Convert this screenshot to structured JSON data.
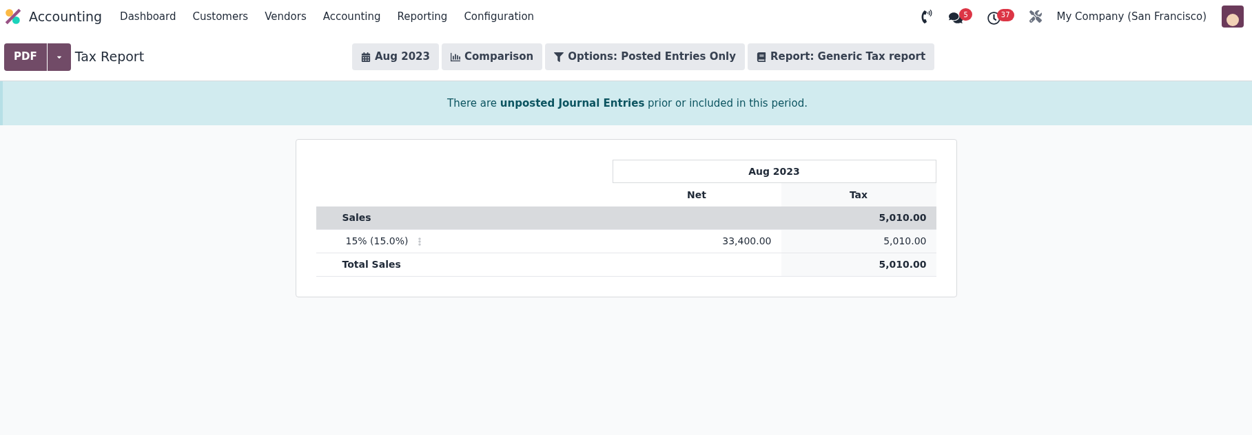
{
  "navbar": {
    "app_name": "Accounting",
    "menu": [
      "Dashboard",
      "Customers",
      "Vendors",
      "Accounting",
      "Reporting",
      "Configuration"
    ],
    "systray": {
      "messages_count": "5",
      "activities_count": "37",
      "company": "My Company (San Francisco)"
    }
  },
  "control_panel": {
    "print_button": "PDF",
    "title": "Tax Report",
    "filters": [
      {
        "kind": "date",
        "label": "Aug 2023"
      },
      {
        "kind": "comparison",
        "label": "Comparison"
      },
      {
        "kind": "options",
        "label": "Options: Posted Entries Only"
      },
      {
        "kind": "report",
        "label": "Report: Generic Tax report"
      }
    ]
  },
  "alert": {
    "text_before": "There are ",
    "link": "unposted Journal Entries",
    "text_after": " prior or included in this period."
  },
  "report": {
    "period": "Aug 2023",
    "columns": [
      "Net",
      "Tax"
    ],
    "rows": [
      {
        "kind": "section",
        "name": "Sales",
        "net": "",
        "tax": "5,010.00"
      },
      {
        "kind": "line",
        "name": "15% (15.0%)",
        "net": "33,400.00",
        "tax": "5,010.00"
      },
      {
        "kind": "total",
        "name": "Total Sales",
        "net": "",
        "tax": "5,010.00"
      }
    ]
  }
}
